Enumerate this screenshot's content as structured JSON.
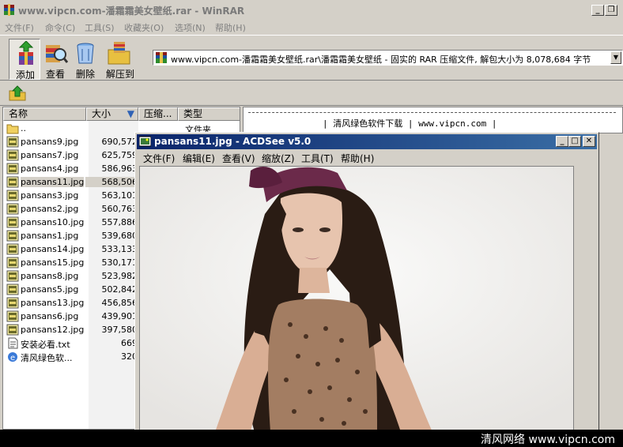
{
  "winrar": {
    "title": "www.vipcn.com-潘霜霜美女壁纸.rar - WinRAR",
    "menu": [
      "文件(F)",
      "命令(C)",
      "工具(S)",
      "收藏夹(O)",
      "选项(N)",
      "帮助(H)"
    ],
    "toolbar": {
      "add": "添加",
      "view": "查看",
      "delete": "删除",
      "extract": "解压到"
    },
    "address": "www.vipcn.com-潘霜霜美女壁纸.rar\\潘霜霜美女壁纸 - 固实的 RAR 压缩文件, 解包大小为 8,078,684 字节",
    "columns": {
      "name": "名称",
      "size": "大小",
      "packed": "压缩...",
      "type": "类型"
    },
    "files": [
      {
        "name": "..",
        "size": "",
        "type": "文件夹",
        "icon": "folder-icon"
      },
      {
        "name": "pansans9.jpg",
        "size": "690,572",
        "type": "",
        "icon": "jpg-icon"
      },
      {
        "name": "pansans7.jpg",
        "size": "625,759",
        "type": "",
        "icon": "jpg-icon"
      },
      {
        "name": "pansans4.jpg",
        "size": "586,963",
        "type": "",
        "icon": "jpg-icon"
      },
      {
        "name": "pansans11.jpg",
        "size": "568,506",
        "type": "",
        "icon": "jpg-icon"
      },
      {
        "name": "pansans3.jpg",
        "size": "563,101",
        "type": "",
        "icon": "jpg-icon"
      },
      {
        "name": "pansans2.jpg",
        "size": "560,763",
        "type": "",
        "icon": "jpg-icon"
      },
      {
        "name": "pansans10.jpg",
        "size": "557,886",
        "type": "",
        "icon": "jpg-icon"
      },
      {
        "name": "pansans1.jpg",
        "size": "539,680",
        "type": "",
        "icon": "jpg-icon"
      },
      {
        "name": "pansans14.jpg",
        "size": "533,133",
        "type": "",
        "icon": "jpg-icon"
      },
      {
        "name": "pansans15.jpg",
        "size": "530,171",
        "type": "",
        "icon": "jpg-icon"
      },
      {
        "name": "pansans8.jpg",
        "size": "523,982",
        "type": "",
        "icon": "jpg-icon"
      },
      {
        "name": "pansans5.jpg",
        "size": "502,842",
        "type": "",
        "icon": "jpg-icon"
      },
      {
        "name": "pansans13.jpg",
        "size": "456,856",
        "type": "",
        "icon": "jpg-icon"
      },
      {
        "name": "pansans6.jpg",
        "size": "439,901",
        "type": "",
        "icon": "jpg-icon"
      },
      {
        "name": "pansans12.jpg",
        "size": "397,580",
        "type": "",
        "icon": "jpg-icon"
      },
      {
        "name": "安装必看.txt",
        "size": "669",
        "type": "",
        "icon": "txt-icon"
      },
      {
        "name": "清风绿色软...",
        "size": "320",
        "type": "",
        "icon": "ie-icon"
      }
    ],
    "selected_file": "pansans11.jpg",
    "comment": "| 清风绿色软件下载 | www.vipcn.com |"
  },
  "acdsee": {
    "title": "pansans11.jpg - ACDSee v5.0",
    "menu": [
      "文件(F)",
      "编辑(E)",
      "查看(V)",
      "缩放(Z)",
      "工具(T)",
      "帮助(H)"
    ]
  },
  "watermark": "清风网络 www.vipcn.com"
}
